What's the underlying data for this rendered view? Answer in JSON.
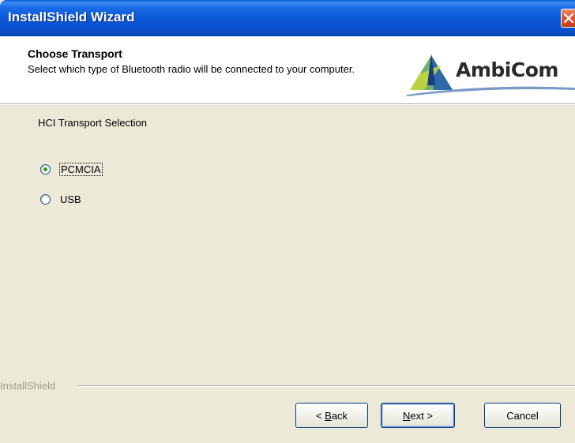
{
  "window": {
    "title": "InstallShield Wizard"
  },
  "header": {
    "title": "Choose Transport",
    "subtitle": "Select which type of Bluetooth radio will be connected to your computer.",
    "logo_text": "AmbiCom"
  },
  "main": {
    "section_label": "HCI Transport Selection",
    "options": [
      {
        "label": "PCMCIA",
        "selected": true
      },
      {
        "label": "USB",
        "selected": false
      }
    ]
  },
  "footer": {
    "brand_label": "InstallShield",
    "buttons": {
      "back_prefix": "< ",
      "back_mnemonic": "B",
      "back_rest": "ack",
      "next_mnemonic": "N",
      "next_rest": "ext >",
      "cancel": "Cancel"
    }
  },
  "colors": {
    "titlebar": "#0a50cc",
    "dialog_bg": "#ece9d8",
    "close_button": "#d9542e",
    "radio_selected": "#21a121"
  },
  "icons": {
    "close": "close-icon",
    "logo": "ambicom-logo-icon"
  }
}
